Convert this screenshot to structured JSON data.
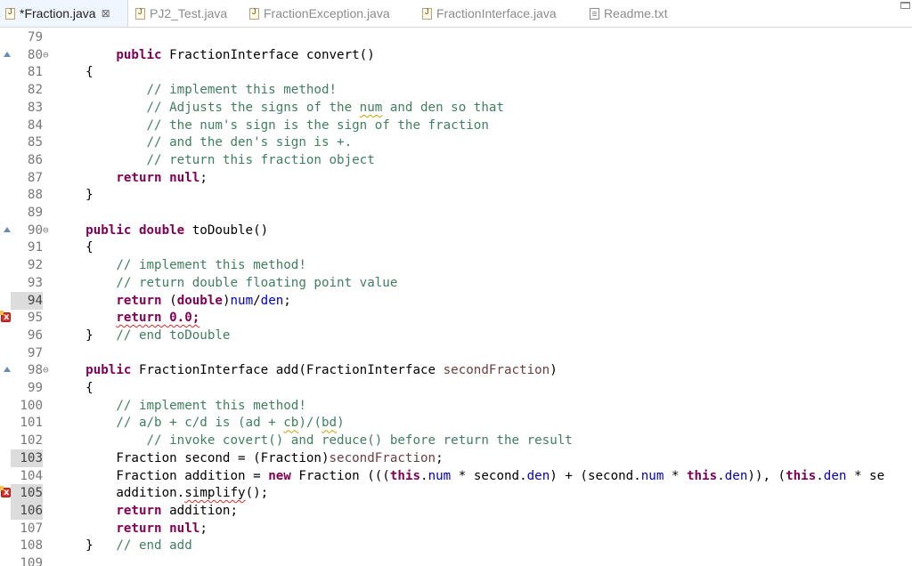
{
  "tabs": [
    {
      "label": "*Fraction.java",
      "icon": "java-file-icon",
      "active": true,
      "close": "⊠"
    },
    {
      "label": "PJ2_Test.java",
      "icon": "java-file-icon"
    },
    {
      "label": "FractionException.java",
      "icon": "java-file-icon"
    },
    {
      "label": "FractionInterface.java",
      "icon": "java-file-icon"
    },
    {
      "label": "Readme.txt",
      "icon": "text-file-icon"
    }
  ],
  "lines": [
    {
      "n": "79"
    },
    {
      "n": "80",
      "fold": "⊖",
      "marker": "override",
      "segs": [
        {
          "t": "        "
        },
        {
          "t": "public",
          "k": "kw"
        },
        {
          "t": " FractionInterface convert()"
        }
      ]
    },
    {
      "n": "81",
      "segs": [
        {
          "t": "    {"
        }
      ]
    },
    {
      "n": "82",
      "segs": [
        {
          "t": "            "
        },
        {
          "t": "// implement this method!",
          "k": "cm"
        }
      ]
    },
    {
      "n": "83",
      "segs": [
        {
          "t": "            "
        },
        {
          "t": "// Adjusts the signs of the ",
          "k": "cm"
        },
        {
          "t": "num",
          "k": "cm warn"
        },
        {
          "t": " and den so that",
          "k": "cm"
        }
      ]
    },
    {
      "n": "84",
      "segs": [
        {
          "t": "            "
        },
        {
          "t": "// the num's sign is the sign of the fraction",
          "k": "cm"
        }
      ]
    },
    {
      "n": "85",
      "segs": [
        {
          "t": "            "
        },
        {
          "t": "// and the den's sign is +.",
          "k": "cm"
        }
      ]
    },
    {
      "n": "86",
      "segs": [
        {
          "t": "            "
        },
        {
          "t": "// return this fraction object",
          "k": "cm"
        }
      ]
    },
    {
      "n": "87",
      "segs": [
        {
          "t": "        "
        },
        {
          "t": "return",
          "k": "kw"
        },
        {
          "t": " "
        },
        {
          "t": "null",
          "k": "kw"
        },
        {
          "t": ";"
        }
      ]
    },
    {
      "n": "88",
      "segs": [
        {
          "t": "    }"
        }
      ]
    },
    {
      "n": "89"
    },
    {
      "n": "90",
      "fold": "⊖",
      "marker": "override",
      "segs": [
        {
          "t": "    "
        },
        {
          "t": "public",
          "k": "kw"
        },
        {
          "t": " "
        },
        {
          "t": "double",
          "k": "kw"
        },
        {
          "t": " toDouble()"
        }
      ]
    },
    {
      "n": "91",
      "segs": [
        {
          "t": "    {"
        }
      ]
    },
    {
      "n": "92",
      "segs": [
        {
          "t": "        "
        },
        {
          "t": "// implement this method!",
          "k": "cm"
        }
      ]
    },
    {
      "n": "93",
      "segs": [
        {
          "t": "        "
        },
        {
          "t": "// return double floating point value",
          "k": "cm"
        }
      ]
    },
    {
      "n": "94",
      "current": true,
      "segs": [
        {
          "t": "        "
        },
        {
          "t": "return",
          "k": "kw"
        },
        {
          "t": " ("
        },
        {
          "t": "double",
          "k": "kw"
        },
        {
          "t": ")"
        },
        {
          "t": "num",
          "k": "fd"
        },
        {
          "t": "/"
        },
        {
          "t": "den",
          "k": "fd"
        },
        {
          "t": ";"
        }
      ]
    },
    {
      "n": "95",
      "marker": "error",
      "segs": [
        {
          "t": "        "
        },
        {
          "t": "return 0.0;",
          "k": "kw squig"
        }
      ]
    },
    {
      "n": "96",
      "segs": [
        {
          "t": "    }   "
        },
        {
          "t": "// end toDouble",
          "k": "cm"
        }
      ]
    },
    {
      "n": "97"
    },
    {
      "n": "98",
      "fold": "⊖",
      "marker": "override",
      "segs": [
        {
          "t": "    "
        },
        {
          "t": "public",
          "k": "kw"
        },
        {
          "t": " FractionInterface add(FractionInterface "
        },
        {
          "t": "secondFraction",
          "k": "fd2"
        },
        {
          "t": ")"
        }
      ]
    },
    {
      "n": "99",
      "segs": [
        {
          "t": "    {"
        }
      ]
    },
    {
      "n": "100",
      "segs": [
        {
          "t": "        "
        },
        {
          "t": "// implement this method!",
          "k": "cm"
        }
      ]
    },
    {
      "n": "101",
      "segs": [
        {
          "t": "        "
        },
        {
          "t": "// a/b + c/d is (ad + ",
          "k": "cm"
        },
        {
          "t": "cb",
          "k": "cm warn"
        },
        {
          "t": ")/(",
          "k": "cm"
        },
        {
          "t": "bd",
          "k": "cm warn"
        },
        {
          "t": ")",
          "k": "cm"
        }
      ]
    },
    {
      "n": "102",
      "segs": [
        {
          "t": "            "
        },
        {
          "t": "// invoke covert() and reduce() before return the result",
          "k": "cm"
        }
      ]
    },
    {
      "n": "103",
      "current": true,
      "segs": [
        {
          "t": "        Fraction "
        },
        {
          "t": "second",
          "k": "fd3"
        },
        {
          "t": " = (Fraction)"
        },
        {
          "t": "secondFraction",
          "k": "fd2"
        },
        {
          "t": ";"
        }
      ]
    },
    {
      "n": "104",
      "segs": [
        {
          "t": "        Fraction "
        },
        {
          "t": "addition",
          "k": "fd3"
        },
        {
          "t": " = "
        },
        {
          "t": "new",
          "k": "kw"
        },
        {
          "t": " Fraction ((("
        },
        {
          "t": "this",
          "k": "kw"
        },
        {
          "t": "."
        },
        {
          "t": "num",
          "k": "fd"
        },
        {
          "t": " * "
        },
        {
          "t": "second",
          "k": "fd3"
        },
        {
          "t": "."
        },
        {
          "t": "den",
          "k": "fd"
        },
        {
          "t": ") + ("
        },
        {
          "t": "second",
          "k": "fd3"
        },
        {
          "t": "."
        },
        {
          "t": "num",
          "k": "fd"
        },
        {
          "t": " * "
        },
        {
          "t": "this",
          "k": "kw"
        },
        {
          "t": "."
        },
        {
          "t": "den",
          "k": "fd"
        },
        {
          "t": ")), ("
        },
        {
          "t": "this",
          "k": "kw"
        },
        {
          "t": "."
        },
        {
          "t": "den",
          "k": "fd"
        },
        {
          "t": " * se"
        }
      ]
    },
    {
      "n": "105",
      "marker": "error",
      "current": true,
      "segs": [
        {
          "t": "        "
        },
        {
          "t": "addition",
          "k": "fd3"
        },
        {
          "t": "."
        },
        {
          "t": "simplify",
          "k": "squig"
        },
        {
          "t": "();"
        }
      ]
    },
    {
      "n": "106",
      "current": true,
      "segs": [
        {
          "t": "        "
        },
        {
          "t": "return",
          "k": "kw"
        },
        {
          "t": " "
        },
        {
          "t": "addition",
          "k": "fd3"
        },
        {
          "t": ";"
        }
      ]
    },
    {
      "n": "107",
      "segs": [
        {
          "t": "        "
        },
        {
          "t": "return",
          "k": "kw"
        },
        {
          "t": " "
        },
        {
          "t": "null",
          "k": "kw"
        },
        {
          "t": ";"
        }
      ]
    },
    {
      "n": "108",
      "segs": [
        {
          "t": "    }   "
        },
        {
          "t": "// end add",
          "k": "cm"
        }
      ]
    },
    {
      "n": "109"
    }
  ]
}
